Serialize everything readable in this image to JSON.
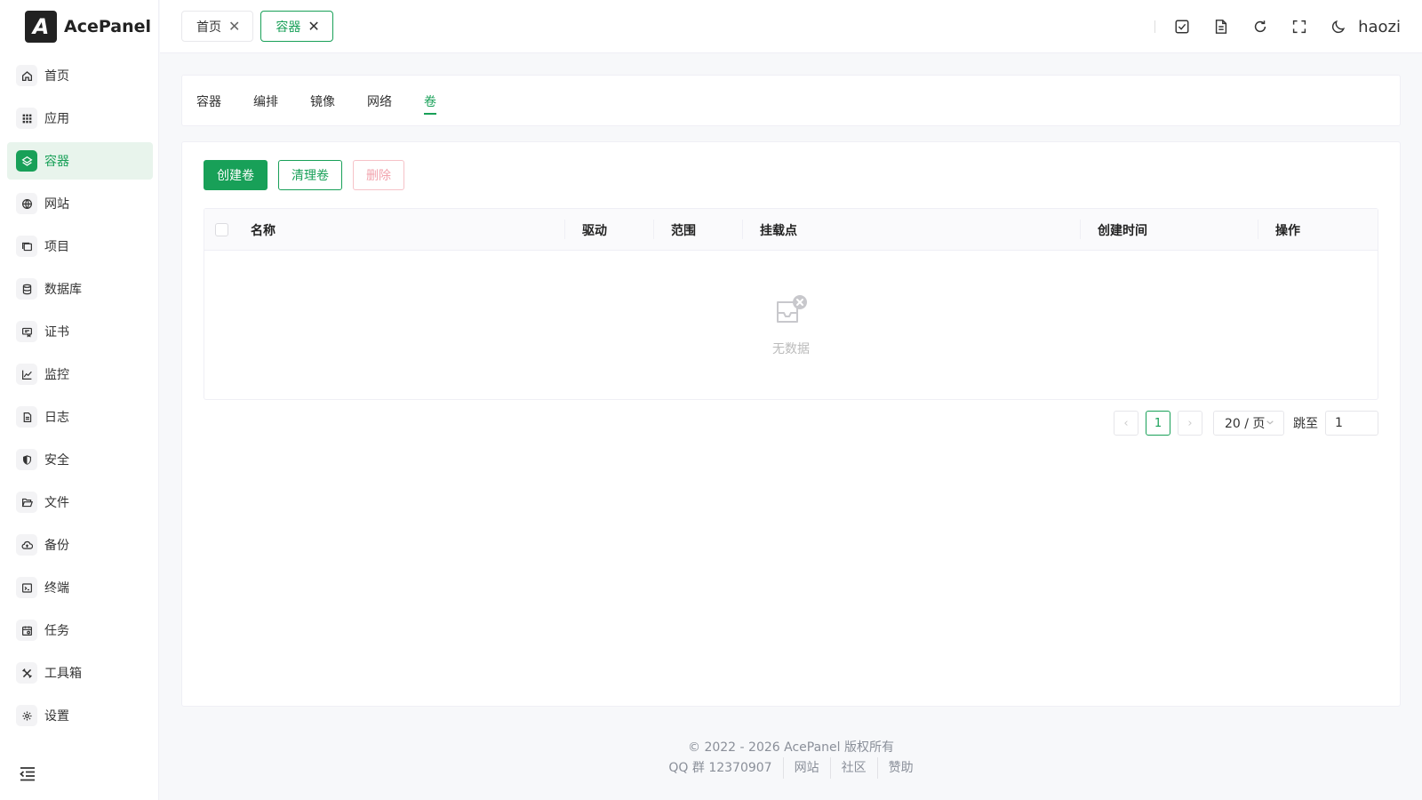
{
  "app": {
    "name": "AcePanel",
    "logo_letter": "A"
  },
  "sidebar": {
    "items": [
      {
        "label": "首页",
        "icon": "home-icon"
      },
      {
        "label": "应用",
        "icon": "grid-icon"
      },
      {
        "label": "容器",
        "icon": "layers-icon",
        "active": true
      },
      {
        "label": "网站",
        "icon": "globe-icon"
      },
      {
        "label": "项目",
        "icon": "folders-icon"
      },
      {
        "label": "数据库",
        "icon": "database-icon"
      },
      {
        "label": "证书",
        "icon": "certificate-icon"
      },
      {
        "label": "监控",
        "icon": "chart-line-icon"
      },
      {
        "label": "日志",
        "icon": "file-text-icon"
      },
      {
        "label": "安全",
        "icon": "shield-icon"
      },
      {
        "label": "文件",
        "icon": "folder-open-icon"
      },
      {
        "label": "备份",
        "icon": "cloud-icon"
      },
      {
        "label": "终端",
        "icon": "terminal-icon"
      },
      {
        "label": "任务",
        "icon": "calendar-icon"
      },
      {
        "label": "工具箱",
        "icon": "tools-icon"
      },
      {
        "label": "设置",
        "icon": "gear-icon"
      }
    ]
  },
  "header": {
    "tabs": [
      {
        "label": "首页",
        "active": false
      },
      {
        "label": "容器",
        "active": true
      }
    ],
    "username": "haozi"
  },
  "subtabs": {
    "items": [
      "容器",
      "编排",
      "镜像",
      "网络",
      "卷"
    ],
    "active_index": 4
  },
  "toolbar": {
    "create_label": "创建卷",
    "prune_label": "清理卷",
    "delete_label": "删除"
  },
  "table": {
    "columns": [
      "名称",
      "驱动",
      "范围",
      "挂载点",
      "创建时间",
      "操作"
    ],
    "empty_text": "无数据"
  },
  "pagination": {
    "prev": "‹",
    "next": "›",
    "current_page": "1",
    "page_size": "20 / 页",
    "jump_label": "跳至",
    "jump_value": "1"
  },
  "footer": {
    "copyright": "© 2022 - 2026 AcePanel 版权所有",
    "links": [
      "QQ 群 12370907",
      "网站",
      "社区",
      "赞助"
    ]
  },
  "colors": {
    "primary": "#18a058",
    "danger_light": "#f2a3ad",
    "active_bg": "#e8f4ec"
  }
}
